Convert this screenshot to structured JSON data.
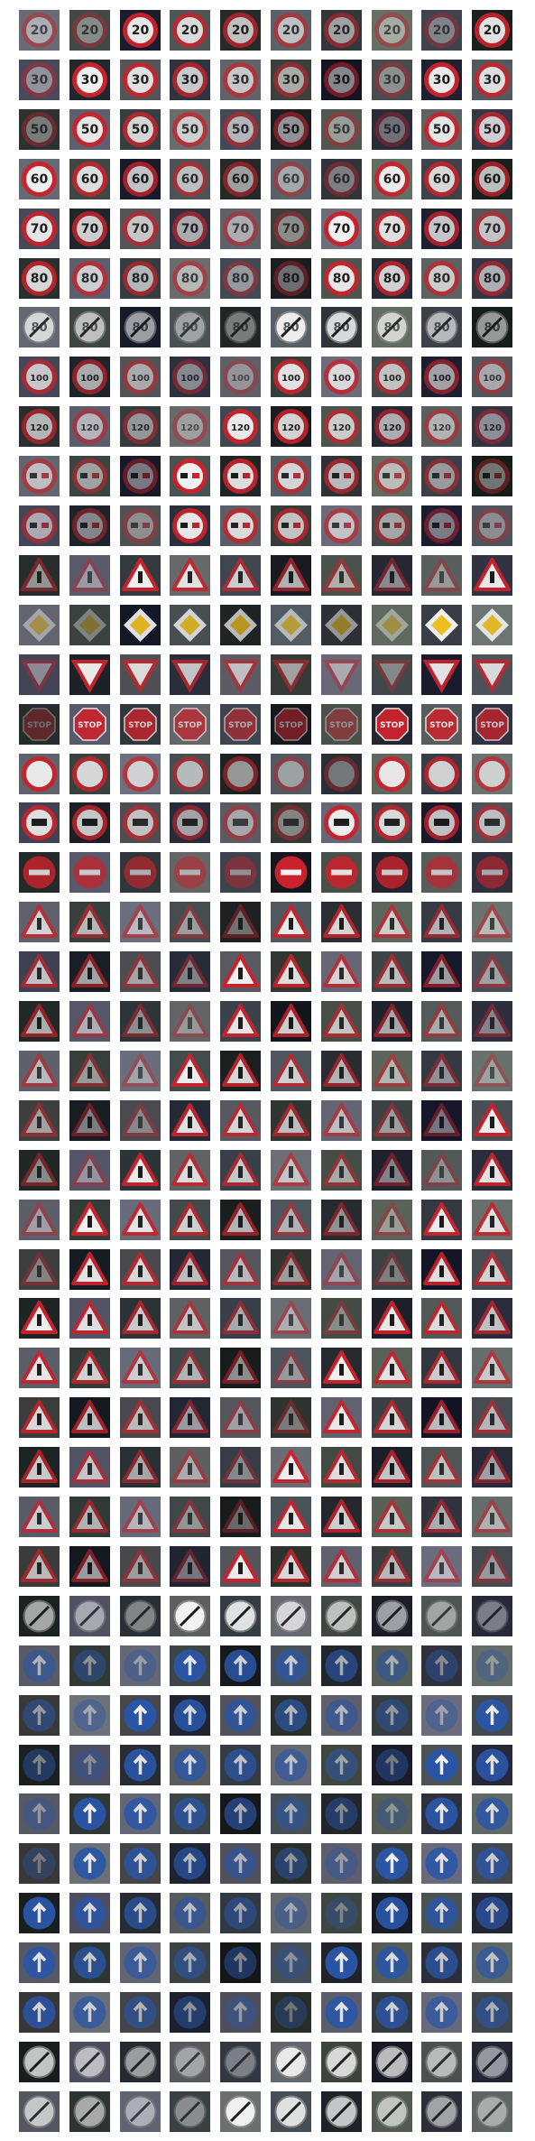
{
  "grid": {
    "columns": 10,
    "rows": 43,
    "background": "#ffffff",
    "classes": [
      {
        "kind": "speed",
        "text": "20"
      },
      {
        "kind": "speed",
        "text": "30"
      },
      {
        "kind": "speed",
        "text": "50"
      },
      {
        "kind": "speed",
        "text": "60"
      },
      {
        "kind": "speed",
        "text": "70"
      },
      {
        "kind": "speed",
        "text": "80"
      },
      {
        "kind": "end-speed",
        "text": "80"
      },
      {
        "kind": "speed",
        "text": "100"
      },
      {
        "kind": "speed",
        "text": "120"
      },
      {
        "kind": "no-overtaking"
      },
      {
        "kind": "no-overtaking-trucks"
      },
      {
        "kind": "warning-priority-crossing"
      },
      {
        "kind": "priority-road"
      },
      {
        "kind": "yield"
      },
      {
        "kind": "stop",
        "text": "STOP"
      },
      {
        "kind": "no-vehicles"
      },
      {
        "kind": "no-trucks"
      },
      {
        "kind": "no-entry"
      },
      {
        "kind": "warning-general"
      },
      {
        "kind": "warning-curve-left"
      },
      {
        "kind": "warning-curve-right"
      },
      {
        "kind": "warning-double-curve"
      },
      {
        "kind": "warning-bumpy-road"
      },
      {
        "kind": "warning-slippery-road"
      },
      {
        "kind": "warning-road-narrows"
      },
      {
        "kind": "warning-road-work"
      },
      {
        "kind": "warning-traffic-signals"
      },
      {
        "kind": "warning-pedestrians"
      },
      {
        "kind": "warning-children"
      },
      {
        "kind": "warning-bicycles"
      },
      {
        "kind": "warning-ice-snow"
      },
      {
        "kind": "warning-wild-animals"
      },
      {
        "kind": "end-all-limits"
      },
      {
        "kind": "turn-right-ahead"
      },
      {
        "kind": "turn-left-ahead"
      },
      {
        "kind": "ahead-only"
      },
      {
        "kind": "straight-or-right"
      },
      {
        "kind": "straight-or-left"
      },
      {
        "kind": "keep-right"
      },
      {
        "kind": "keep-left"
      },
      {
        "kind": "roundabout"
      },
      {
        "kind": "end-no-overtaking"
      },
      {
        "kind": "end-no-overtaking-trucks"
      }
    ]
  }
}
